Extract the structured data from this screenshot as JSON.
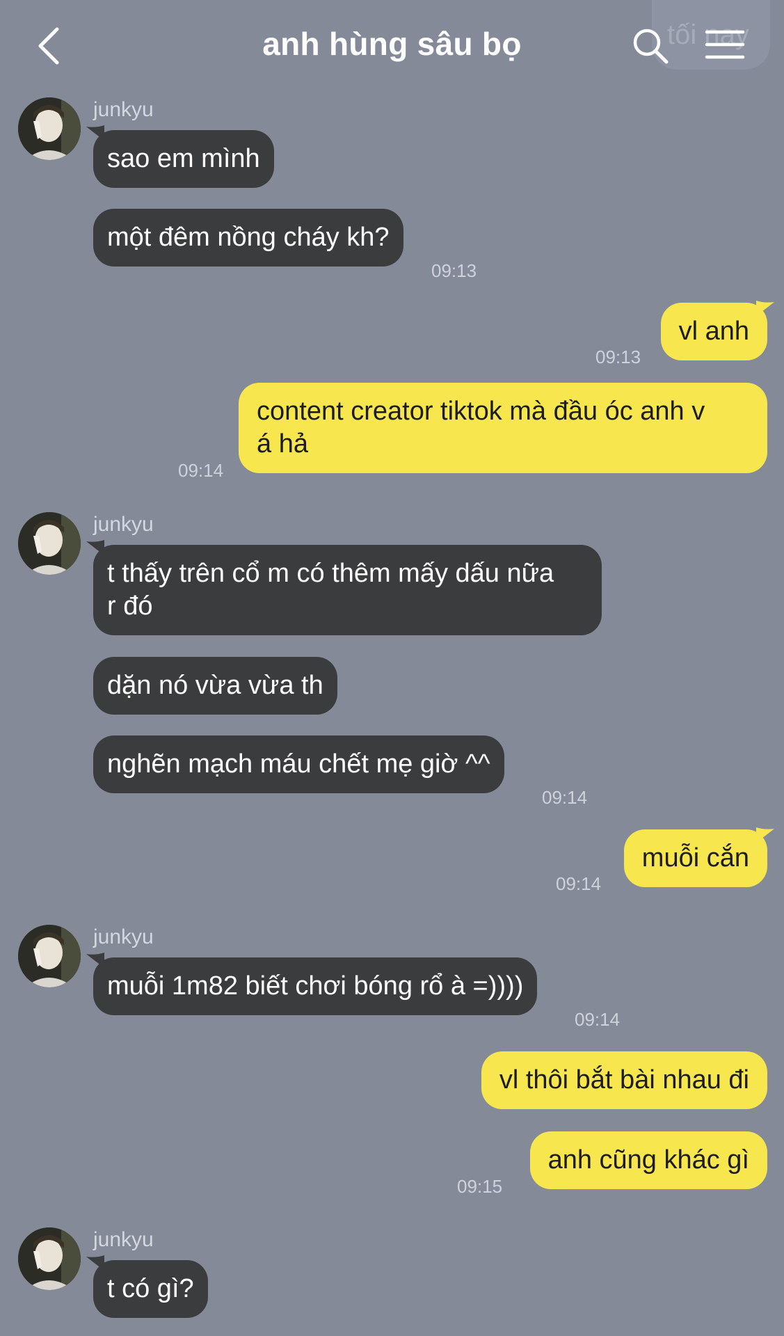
{
  "header": {
    "title": "anh hùng sâu bọ",
    "ghost_text": "tối nay"
  },
  "colors": {
    "background": "#858a99",
    "incoming_bubble": "#3b3c3e",
    "outgoing_bubble": "#f7e64d"
  },
  "icons": [
    "chevron-left-icon",
    "search-icon",
    "hamburger-menu-icon"
  ],
  "messages": [
    {
      "sender": "junkyu",
      "text": "sao em mình"
    },
    {
      "text": "một đêm nồng cháy kh?",
      "time": "09:13"
    },
    {
      "text": "vl anh",
      "time": "09:13"
    },
    {
      "text": "content creator tiktok mà đầu óc anh v\ná hả",
      "time": "09:14"
    },
    {
      "sender": "junkyu",
      "text": "t thấy trên cổ m có thêm mấy dấu nữa\nr đó"
    },
    {
      "text": "dặn nó vừa vừa th"
    },
    {
      "text": "nghẽn mạch máu chết mẹ giờ ^^",
      "time": "09:14"
    },
    {
      "text": "muỗi cắn",
      "time": "09:14"
    },
    {
      "sender": "junkyu",
      "text": "muỗi 1m82 biết chơi bóng rổ à =))))",
      "time": "09:14"
    },
    {
      "text": "vl thôi bắt bài nhau đi"
    },
    {
      "text": "anh cũng khác gì",
      "time": "09:15"
    },
    {
      "sender": "junkyu",
      "text": "t có gì?"
    }
  ]
}
